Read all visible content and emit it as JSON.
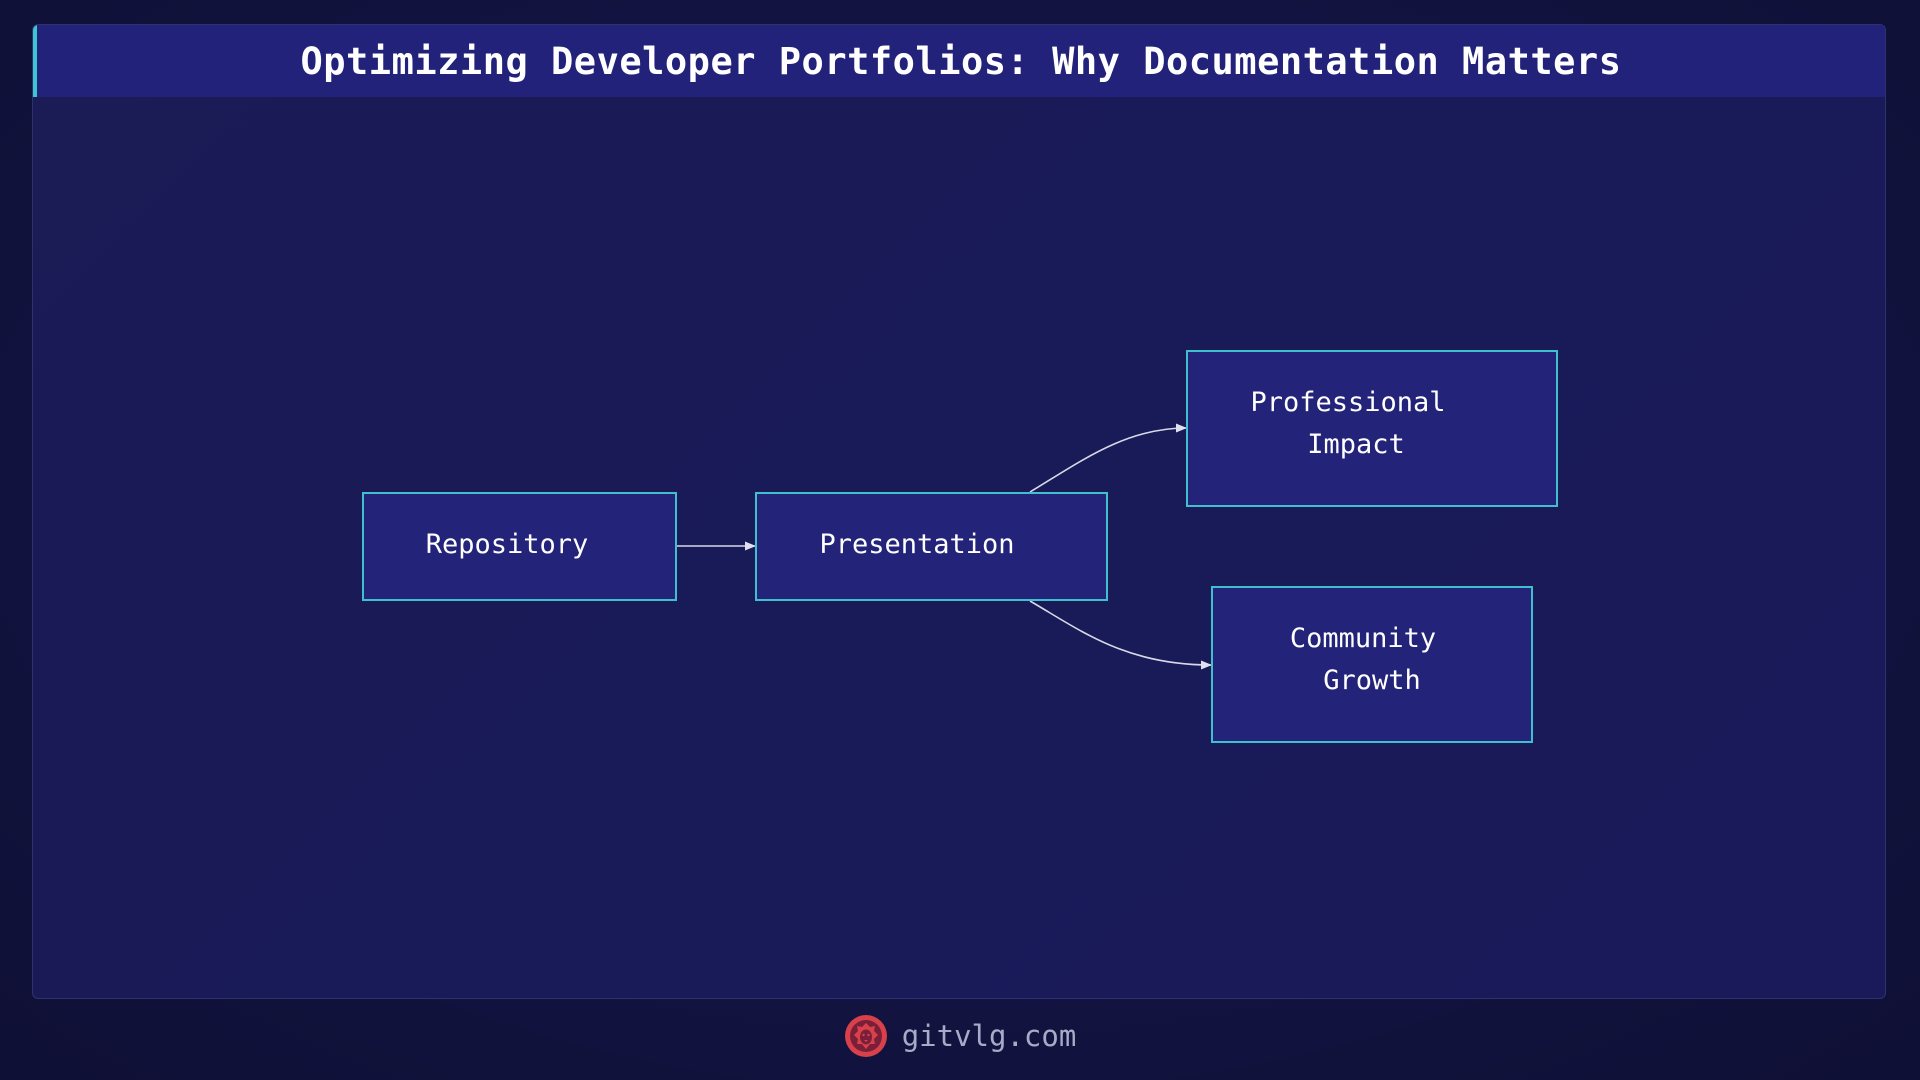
{
  "header": {
    "title": "Optimizing Developer Portfolios: Why Documentation Matters"
  },
  "diagram": {
    "nodes": [
      {
        "id": "repository",
        "label_lines": [
          "Repository"
        ]
      },
      {
        "id": "presentation",
        "label_lines": [
          "Presentation"
        ]
      },
      {
        "id": "professional-impact",
        "label_lines": [
          "Professional",
          "Impact"
        ]
      },
      {
        "id": "community-growth",
        "label_lines": [
          "Community",
          "Growth"
        ]
      }
    ],
    "edges": [
      {
        "from": "repository",
        "to": "presentation"
      },
      {
        "from": "presentation",
        "to": "professional-impact"
      },
      {
        "from": "presentation",
        "to": "community-growth"
      }
    ]
  },
  "footer": {
    "logo": "lion-head-icon",
    "site": "gitvlg.com"
  },
  "colors": {
    "background": "#11123a",
    "panel": "#1a1a55",
    "header": "#22227a",
    "accent": "#3fc5d0",
    "node_fill": "#23237a",
    "node_border": "#3fc0cc",
    "logo": "#d8404a"
  }
}
